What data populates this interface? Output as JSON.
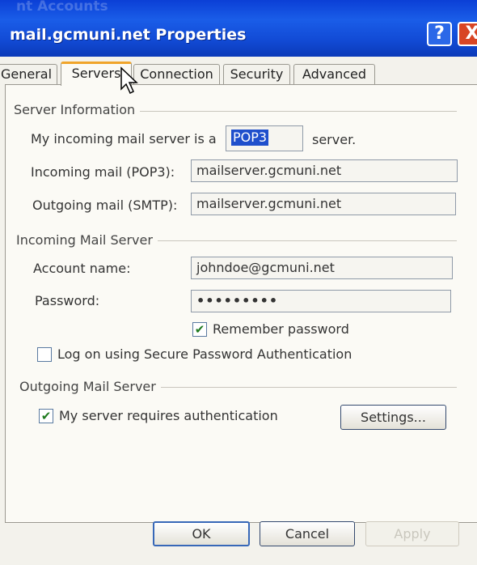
{
  "window": {
    "ghost_title": "nt Accounts",
    "title": "mail.gcmuni.net Properties",
    "help_glyph": "?",
    "close_glyph": "X"
  },
  "tabs": [
    {
      "label": "General",
      "active": false
    },
    {
      "label": "Servers",
      "active": true
    },
    {
      "label": "Connection",
      "active": false
    },
    {
      "label": "Security",
      "active": false
    },
    {
      "label": "Advanced",
      "active": false
    }
  ],
  "server_information": {
    "group_label": "Server Information",
    "server_type_prefix": "My incoming mail server is a",
    "server_type_value": "POP3",
    "server_type_suffix": "server.",
    "incoming_label": "Incoming mail (POP3):",
    "incoming_value": "mailserver.gcmuni.net",
    "outgoing_label": "Outgoing mail (SMTP):",
    "outgoing_value": "mailserver.gcmuni.net"
  },
  "incoming_mail_server": {
    "group_label": "Incoming Mail Server",
    "account_label": "Account name:",
    "account_value": "johndoe@gcmuni.net",
    "password_label": "Password:",
    "password_value": "•••••••••",
    "remember_password_label": "Remember password",
    "remember_password_checked": true,
    "spa_label": "Log on using Secure Password Authentication",
    "spa_checked": false
  },
  "outgoing_mail_server": {
    "group_label": "Outgoing Mail Server",
    "requires_auth_label": "My server requires authentication",
    "requires_auth_checked": true,
    "settings_label": "Settings..."
  },
  "buttons": {
    "ok": "OK",
    "cancel": "Cancel",
    "apply": "Apply"
  },
  "colors": {
    "titlebar": "#124bd6",
    "active_tab_highlight": "#f0a42a",
    "close_button": "#d84524",
    "check_mark": "#1e7a1e"
  }
}
